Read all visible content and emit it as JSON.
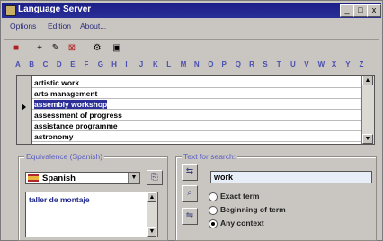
{
  "window": {
    "title": "Language Server"
  },
  "menubar": {
    "items": [
      "Options",
      "Edition",
      "About..."
    ]
  },
  "title_buttons": [
    "_",
    "□",
    "x"
  ],
  "toolbar": {
    "icons": [
      "exit-icon",
      "new-icon",
      "edit-icon",
      "delete-icon",
      "tools-icon",
      "window-icon"
    ],
    "glyphs": [
      "■",
      "+",
      "✎",
      "⊠",
      "⚙",
      "▣"
    ]
  },
  "alphabet": [
    "A",
    "B",
    "C",
    "D",
    "E",
    "F",
    "G",
    "H",
    "I",
    "J",
    "K",
    "L",
    "M",
    "N",
    "O",
    "P",
    "Q",
    "R",
    "S",
    "T",
    "U",
    "V",
    "W",
    "X",
    "Y",
    "Z"
  ],
  "terms_list": {
    "items": [
      "artistic work",
      "arts management",
      "assembly workshop",
      "assessment of progress",
      "assistance programme",
      "astronomy"
    ],
    "selected_index": 2
  },
  "equivalence": {
    "label": "Equivalence (Spanish)",
    "language": "Spanish",
    "button_glyph": "⎘",
    "translation": "taller de montaje"
  },
  "search": {
    "label": "Text for search:",
    "value": "work",
    "button_glyphs": [
      "⇆",
      "⌕",
      "⇋"
    ],
    "options": [
      "Exact term",
      "Beginning of term",
      "Any context"
    ],
    "selected_option": 2
  }
}
